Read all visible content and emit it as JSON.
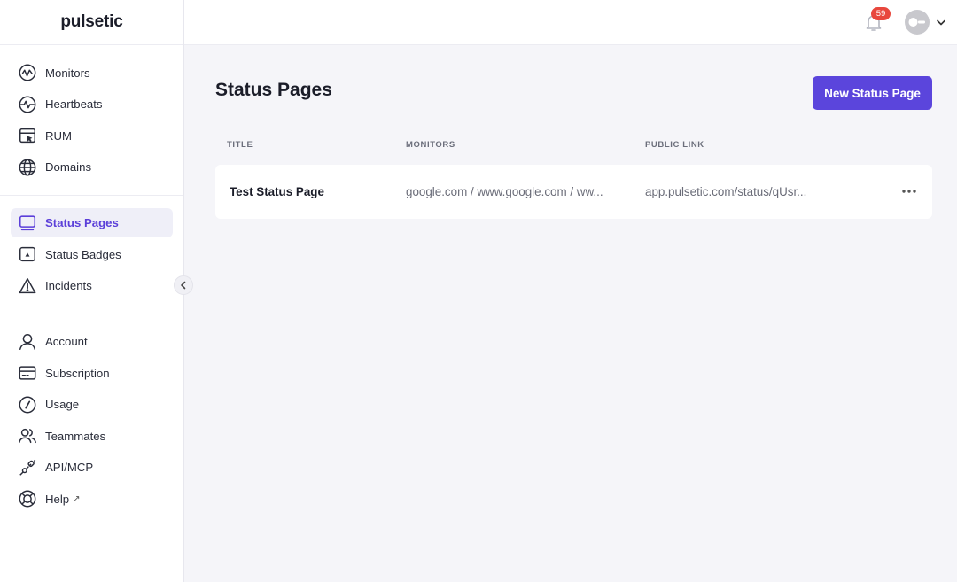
{
  "app": {
    "name": "pulsetic"
  },
  "sidebar": {
    "groups": [
      [
        {
          "label": "Monitors",
          "icon": "monitor-pulse-icon"
        },
        {
          "label": "Heartbeats",
          "icon": "heartbeat-icon"
        },
        {
          "label": "RUM",
          "icon": "rum-window-icon"
        },
        {
          "label": "Domains",
          "icon": "globe-icon"
        }
      ],
      [
        {
          "label": "Status Pages",
          "icon": "status-page-icon",
          "active": true
        },
        {
          "label": "Status Badges",
          "icon": "status-badge-icon"
        },
        {
          "label": "Incidents",
          "icon": "warning-icon"
        }
      ],
      [
        {
          "label": "Account",
          "icon": "user-icon"
        },
        {
          "label": "Subscription",
          "icon": "credit-card-icon"
        },
        {
          "label": "Usage",
          "icon": "gauge-icon"
        },
        {
          "label": "Teammates",
          "icon": "users-icon"
        },
        {
          "label": "API/MCP",
          "icon": "plug-icon"
        },
        {
          "label": "Help",
          "icon": "lifebuoy-icon",
          "external": "↗"
        }
      ]
    ]
  },
  "header": {
    "notification_count": "59"
  },
  "page": {
    "title": "Status Pages",
    "new_button": "New Status Page",
    "columns": {
      "title": "TITLE",
      "monitors": "MONITORS",
      "public_link": "PUBLIC LINK"
    },
    "rows": [
      {
        "title": "Test Status Page",
        "monitors": "google.com / www.google.com / ww...",
        "public_link": "app.pulsetic.com/status/qUsr..."
      }
    ]
  },
  "colors": {
    "accent": "#5b45dc",
    "active_text": "#5b3fd9",
    "badge": "#e8473d"
  }
}
